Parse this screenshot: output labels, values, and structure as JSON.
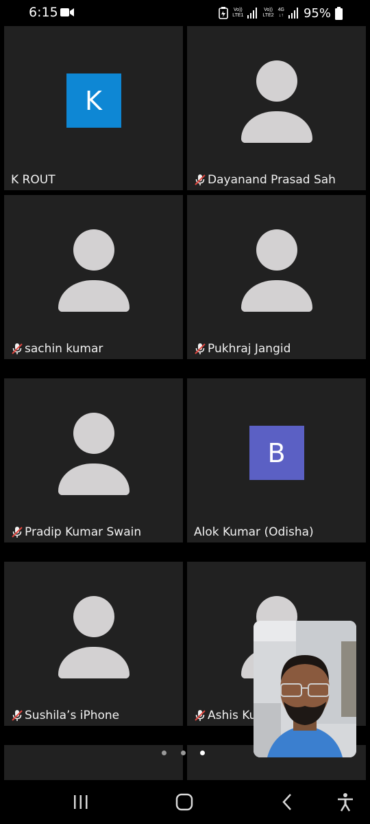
{
  "status_bar": {
    "time": "6:15",
    "sim1_top": "Vo))",
    "sim1_bottom": "LTE1",
    "sim2_top": "Vo))",
    "sim2_bottom": "LTE2",
    "network_type": "4G",
    "battery_percent": "95%"
  },
  "participants": [
    {
      "name": "K ROUT",
      "avatar": "initial",
      "initial": "K",
      "avatar_color": "#0e87d4",
      "muted": false
    },
    {
      "name": "Dayanand Prasad Sah",
      "avatar": "silhouette",
      "muted": true
    },
    {
      "name": "sachin kumar",
      "avatar": "silhouette",
      "muted": true
    },
    {
      "name": "Pukhraj Jangid",
      "avatar": "silhouette",
      "muted": true
    },
    {
      "name": "Pradip Kumar Swain",
      "avatar": "silhouette",
      "muted": true
    },
    {
      "name": "Alok Kumar (Odisha)",
      "avatar": "initial",
      "initial": "B",
      "avatar_color": "#5b60c4",
      "muted": false
    },
    {
      "name": "Sushila’s iPhone",
      "avatar": "silhouette",
      "muted": true
    },
    {
      "name": "Ashis Ku",
      "avatar": "silhouette",
      "muted": true
    }
  ],
  "pagination": {
    "total_pages": 3,
    "current_page": 3
  },
  "colors": {
    "tile_background": "#212121",
    "app_background": "#000000",
    "silhouette": "#d3d1d2"
  },
  "nav_icons": [
    "recent-apps-icon",
    "home-icon",
    "back-icon",
    "accessibility-icon"
  ]
}
